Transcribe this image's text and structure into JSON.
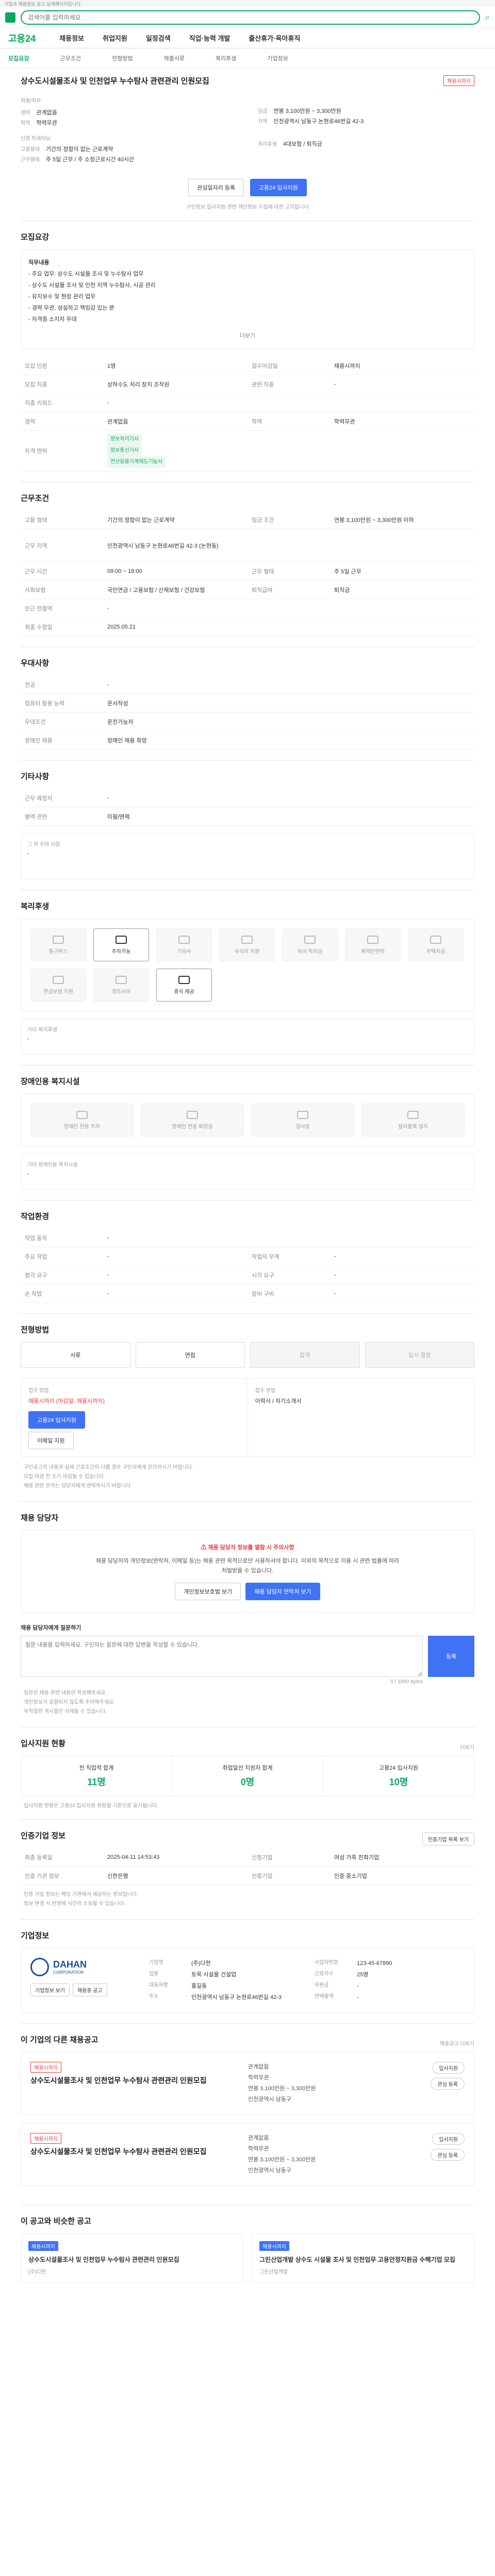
{
  "top": {
    "notice": "기업과 채용정보 공고 상세페이지입니다"
  },
  "search": {
    "placeholder": "검색어를 입력하세요"
  },
  "nav": {
    "brand": "고용24",
    "items": [
      "채용정보",
      "취업지원",
      "일정검색",
      "직업·능력 개발",
      "출산휴가·육아휴직"
    ]
  },
  "subnav": {
    "items": [
      "모집요강",
      "근무조건",
      "전형방법",
      "제출서류",
      "복리후생",
      "기업정보"
    ],
    "active_index": 0
  },
  "header": {
    "title": "상수도시설물조사 및 인천업무 누수탐사 관련관리 인원모집",
    "badge": "채용시까지",
    "company_label": "직종/직무",
    "company": "신영 트레이닝",
    "info": [
      {
        "label": "경력",
        "value": "관계없음"
      },
      {
        "label": "학력",
        "value": "학력무관"
      },
      {
        "label": "임금",
        "value": "연봉 3,100만원 ~ 3,300만원"
      },
      {
        "label": "지역",
        "value": "인천광역시 남동구 논현로46번길 42-3"
      },
      {
        "label": "고용형태",
        "value": "기간의 정함이 없는 근로계약"
      },
      {
        "label": "근무형태",
        "value": "주 5일 근무 / 주 소정근로시간 40시간"
      },
      {
        "label": "복리후생",
        "value": "4대보험 / 퇴직금"
      }
    ],
    "btn_scrap": "관심일자리 등록",
    "btn_apply": "고용24 입사지원",
    "notice": "구인정보 입사지원 관련 개인정보 수집에 대한 고지입니다"
  },
  "recruit": {
    "title": "모집요강",
    "duty_head": "직무내용",
    "duty": [
      "- 주요 업무: 상수도 시설물 조사 및 누수탐사 업무",
      "- 상수도 시설물 조사 및 인천 지역 누수탐사, 시공 관리",
      "- 유지보수 및 현장 관리 업무",
      "- 경력 무관, 성실하고 책임감 있는 분",
      "- 자격증 소지자 우대"
    ],
    "more": "더보기",
    "rows": [
      {
        "label": "모집 인원",
        "value": "1명",
        "label2": "접수마감일",
        "value2": "채용시까지"
      },
      {
        "label": "모집 직종",
        "value": "상하수도 처리 장치 조작원",
        "label2": "관련 직종",
        "value2": "-"
      },
      {
        "label": "직종 키워드",
        "value": "-"
      },
      {
        "label": "경력",
        "value": "관계없음",
        "label2": "학력",
        "value2": "학력무관"
      }
    ],
    "license_label": "자격 면허",
    "licenses": [
      "정보처리기사",
      "정보통신기사",
      "전산응용기계제도기능사"
    ]
  },
  "work": {
    "title": "근무조건",
    "rows": [
      {
        "label": "고용 형태",
        "value": "기간의 정함이 없는 근로계약",
        "label2": "임금 조건",
        "value2": "연봉 3,100만원 ~ 3,300만원 이하"
      },
      {
        "label": "근무 지역",
        "value": "인천광역시 남동구 논현로46번길 42-3 (논현동)"
      },
      {
        "label": "근무 시간",
        "value": "09:00 ~ 18:00",
        "label2": "근무 형태",
        "value2": "주 5일 근무"
      },
      {
        "label": "사회보험",
        "value": "국민연금 / 고용보험 / 산재보험 / 건강보험",
        "label2": "퇴직급여",
        "value2": "퇴직금"
      },
      {
        "label": "인근 전철역",
        "value": "-"
      },
      {
        "label": "최종 수정일",
        "value": "2025.05.21"
      }
    ]
  },
  "apply_cond": {
    "title": "우대사항",
    "rows": [
      {
        "label": "전공",
        "value": "-"
      },
      {
        "label": "컴퓨터 활용 능력",
        "value": "문서작성"
      },
      {
        "label": "우대조건",
        "value": "운전가능자"
      },
      {
        "label": "장애인 채용",
        "value": "장애인 채용 희망"
      }
    ]
  },
  "etc": {
    "title": "기타사항",
    "rows": [
      {
        "label": "근무 예정지",
        "value": "-"
      },
      {
        "label": "병역 관련",
        "value": "미필/면제"
      }
    ]
  },
  "extra_desc": {
    "label": "그 외 우대 사항",
    "value": "-"
  },
  "welfare": {
    "title": "복리후생",
    "items": [
      {
        "name": "통근버스",
        "on": false
      },
      {
        "name": "주차가능",
        "on": true
      },
      {
        "name": "기숙사",
        "on": false
      },
      {
        "name": "숙식비 지원",
        "on": false
      },
      {
        "name": "자녀 학자금",
        "on": false
      },
      {
        "name": "체력단련비",
        "on": false
      },
      {
        "name": "주택자금",
        "on": false
      },
      {
        "name": "연금보험 지원",
        "on": false
      },
      {
        "name": "경조사비",
        "on": false
      },
      {
        "name": "중식 제공",
        "on": true
      }
    ],
    "extra_label": "기타 복리후생",
    "extra_value": "-"
  },
  "disability": {
    "title": "장애인용 복지시설",
    "items": [
      "장애인 전용 주차",
      "장애인 전용 화장실",
      "경사로",
      "점자블록 설치"
    ],
    "extra_label": "기타 장애인용 복지시설",
    "extra_value": "-"
  },
  "env": {
    "title": "작업환경",
    "rows": [
      {
        "label": "작업 동작",
        "value": "-",
        "label2": "",
        "value2": ""
      },
      {
        "label": "주요 작업",
        "value": "-",
        "label2": "작업자 무게",
        "value2": "-"
      },
      {
        "label": "청각 요구",
        "value": "-",
        "label2": "시각 요구",
        "value2": "-"
      },
      {
        "label": "손 작업",
        "value": "-",
        "label2": "장비 구비",
        "value2": "-"
      }
    ]
  },
  "screening": {
    "title": "전형방법",
    "steps": [
      "서류",
      "면접",
      "합격",
      "입사 결정"
    ],
    "method_head": "접수 방법",
    "method_value": "채용시까지 (마감일: 채용시까지)",
    "method_btn1": "고용24 입사지원",
    "method_btn2": "이메일 지원",
    "docs_head": "접수 방법",
    "docs_value": "이력서 / 자기소개서",
    "notes": [
      "· 구인공고의 내용과 실제 근로조건이 다를 경우 구인자에게 문의하시기 바랍니다.",
      "· 모집 마감 전 조기 마감될 수 있습니다.",
      "· 채용 관련 문의는 담당자에게 연락하시기 바랍니다."
    ]
  },
  "contact": {
    "title": "채용 담당자",
    "alert_title": "채용 담당자 정보를 열람 시 주의사항",
    "alert_body": "채용 담당자의 개인정보(연락처, 이메일 등)는 채용 관련 목적으로만 사용하셔야 합니다. 이외의 목적으로 이용 시 관련 법률에 따라 처벌받을 수 있습니다.",
    "btn_view": "개인정보보호법 보기",
    "btn_contact": "채용 담당자 연락처 보기",
    "q_label": "채용 담당자에게 질문하기",
    "q_placeholder": "질문 내용을 입력하세요. 구인자는 질문에 대한 답변을 작성할 수 있습니다.",
    "q_count": "0 / 1000 bytes",
    "q_btn": "등록",
    "q_notes": [
      "· 질문은 채용 관련 내용만 작성해주세요.",
      "· 개인정보가 포함되지 않도록 주의해주세요.",
      "· 부적절한 게시물은 삭제될 수 있습니다."
    ]
  },
  "stats": {
    "title": "입사지원 현황",
    "more": "더보기",
    "items": [
      {
        "label": "전 직업적 합계",
        "value": "11명"
      },
      {
        "label": "취업알선 지원자 합계",
        "value": "0명"
      },
      {
        "label": "고용24 입사지원",
        "value": "10명"
      }
    ],
    "note": "· 입사지원 현황은 고용24 입사지원 현황을 기준으로 표시됩니다."
  },
  "company_info": {
    "title": "인증기업 정보",
    "btn": "인증기업 목록 보기",
    "rows": [
      {
        "label": "최종 등록일",
        "value": "2025-04-11 14:53:43",
        "label2": "신청기업",
        "value2": "여성 가족 친화기업"
      },
      {
        "label": "인증 기관 정보",
        "value": "신한은행",
        "label2": "인증기업",
        "value2": "인증 중소기업"
      }
    ],
    "notes": [
      "· 인증 기업 정보는 해당 기관에서 제공하는 정보입니다.",
      "· 정보 변경 시 반영에 시간이 소요될 수 있습니다."
    ]
  },
  "corp": {
    "title": "기업정보",
    "logo_text": "DAHAN",
    "logo_sub": "CORPORATION",
    "btn1": "기업정보 보기",
    "btn2": "채용중 공고",
    "fields": [
      {
        "label": "기업명",
        "value": "(주)다한"
      },
      {
        "label": "업종",
        "value": "토목 시설물 건설업"
      },
      {
        "label": "대표자명",
        "value": "홍길동"
      },
      {
        "label": "주소",
        "value": "인천광역시 남동구 논현로46번길 42-3"
      }
    ],
    "fields2": [
      {
        "label": "사업자번호",
        "value": "123-45-67890"
      },
      {
        "label": "근로자수",
        "value": "25명"
      },
      {
        "label": "자본금",
        "value": "-"
      },
      {
        "label": "연매출액",
        "value": "-"
      }
    ]
  },
  "others": {
    "title": "이 기업의 다른 채용공고",
    "more": "채용공고 더보기",
    "items": [
      {
        "badge": "채용시까지",
        "title": "상수도시설물조사 및 인천업무 누수탐사 관련관리 인원모집",
        "career": "관계없음",
        "edu": "학력무관",
        "pay": "연봉 3,100만원 ~ 3,300만원",
        "region": "인천광역시 남동구",
        "btn1": "입사지원",
        "btn2": "관심 등록"
      },
      {
        "badge": "채용시까지",
        "title": "상수도시설물조사 및 인천업무 누수탐사 관련관리 인원모집",
        "career": "관계없음",
        "edu": "학력무관",
        "pay": "연봉 3,100만원 ~ 3,300만원",
        "region": "인천광역시 남동구",
        "btn1": "입사지원",
        "btn2": "관심 등록"
      }
    ]
  },
  "similar": {
    "title": "이 공고와 비슷한 공고",
    "items": [
      {
        "badge": "채용시까지",
        "title": "상수도시설물조사 및 인천업무 누수탐사 관련관리 인원모집",
        "company": "(주)다한"
      },
      {
        "badge": "채용시까지",
        "title": "그린산업개발 상수도 시설물 조사 및 인천업무 고용안정지원금 수혜기업 모집",
        "company": "그린산업개발"
      }
    ]
  }
}
